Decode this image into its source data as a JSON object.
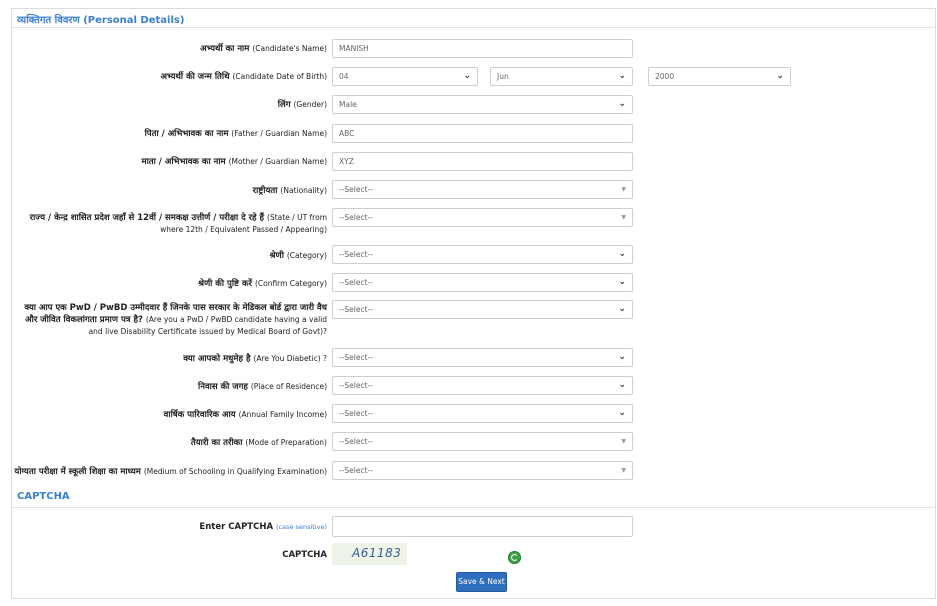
{
  "section_personal": {
    "title_hi": "व्यक्तिगत विवरण",
    "title_en": "(Personal Details)"
  },
  "fields": {
    "name": {
      "label_hi": "अभ्यर्थी का नाम",
      "label_en": "(Candidate's Name)",
      "value": "MANISH"
    },
    "dob": {
      "label_hi": "अभ्यर्थी की जन्म तिथि",
      "label_en": "(Candidate Date of Birth)",
      "day": "04",
      "month": "Jun",
      "year": "2000"
    },
    "gender": {
      "label_hi": "लिंग",
      "label_en": "(Gender)",
      "value": "Male"
    },
    "father": {
      "label_hi": "पिता / अभिभावक का नाम",
      "label_en": "(Father / Guardian Name)",
      "value": "ABC"
    },
    "mother": {
      "label_hi": "माता / अभिभावक का नाम",
      "label_en": "(Mother / Guardian Name)",
      "value": "XYZ"
    },
    "nationality": {
      "label_hi": "राष्ट्रीयता",
      "label_en": "(Nationality)",
      "value": "--Select--"
    },
    "state": {
      "label_hi": "राज्य / केन्द्र शासित प्रदेश जहाँ से 12वीं / समकक्ष उत्तीर्ण / परीक्षा दे रहे हैं",
      "label_en": "(State / UT from where 12th / Equivalent Passed / Appearing)",
      "value": "--Select--"
    },
    "category": {
      "label_hi": "श्रेणी",
      "label_en": "(Category)",
      "value": "--Select--"
    },
    "confirm_category": {
      "label_hi": "श्रेणी की पुष्टि करें",
      "label_en": "(Confirm Category)",
      "value": "--Select--"
    },
    "pwd": {
      "label_hi": "क्या आप एक PwD / PwBD उम्मीदवार हैं जिनके पास सरकार के मेडिकल बोर्ड द्वारा जारी वैध और जीवित विकलांगता प्रमाण पत्र है?",
      "label_en": "(Are you a PwD / PwBD candidate having a valid and live Disability Certificate issued by Medical Board of Govt)?",
      "value": "--Select--"
    },
    "diabetic": {
      "label_hi": "क्या आपको मधुमेह है",
      "label_en": "(Are You Diabetic) ?",
      "value": "--Select--"
    },
    "residence": {
      "label_hi": "निवास की जगह",
      "label_en": "(Place of Residence)",
      "value": "--Select--"
    },
    "income": {
      "label_hi": "वार्षिक पारिवारिक आय",
      "label_en": "(Annual Family Income)",
      "value": "--Select--"
    },
    "preparation": {
      "label_hi": "तैयारी का तरीका",
      "label_en": "(Mode of Preparation)",
      "value": "--Select--"
    },
    "medium": {
      "label_hi": "योग्यता परीक्षा में स्कूली शिक्षा का माध्यम",
      "label_en": "(Medium of Schooling in Qualifying Examination)",
      "value": "--Select--"
    }
  },
  "section_captcha": {
    "title": "CAPTCHA"
  },
  "captcha": {
    "enter_label": "Enter CAPTCHA",
    "case_note": "(case sensitive)",
    "input_value": "",
    "label": "CAPTCHA",
    "code": "A61183"
  },
  "submit_label": "Save & Next",
  "colors": {
    "accent": "#3a7fd5",
    "button": "#2f6fbf",
    "refresh": "#3aa34a"
  },
  "icons": {
    "dropdown": "chevron-down-icon",
    "refresh": "refresh-icon"
  }
}
